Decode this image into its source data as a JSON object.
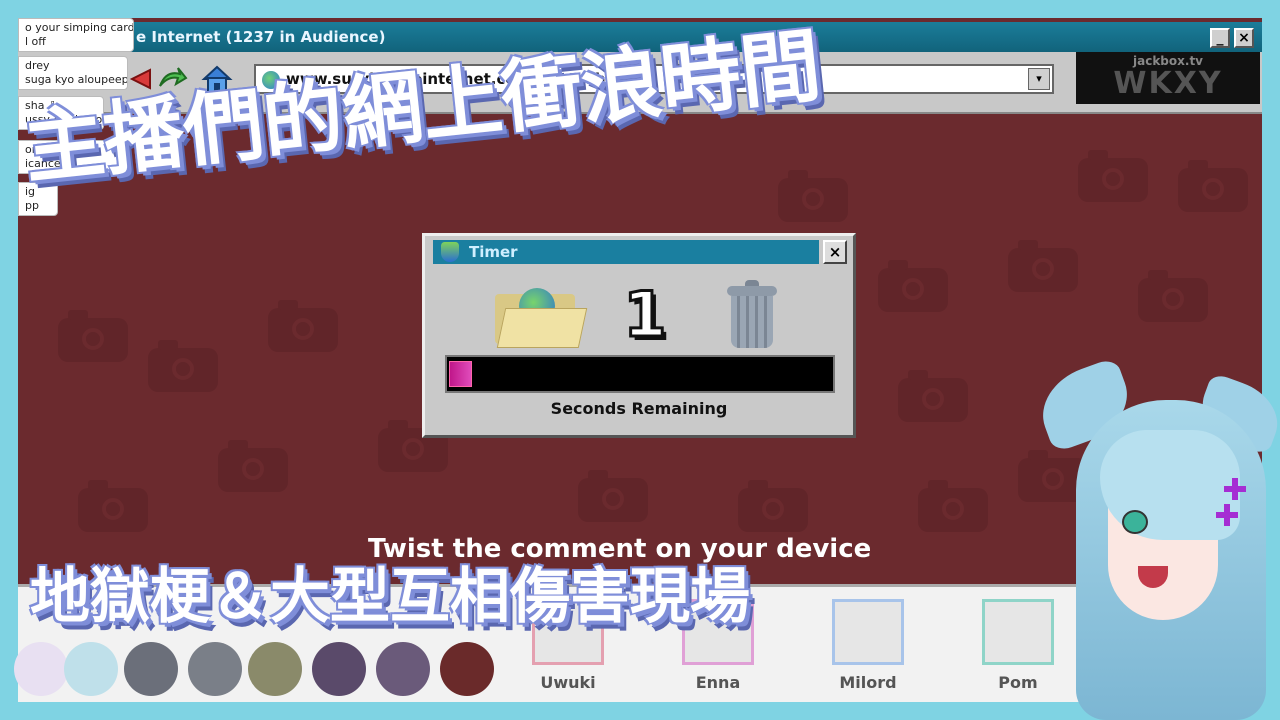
{
  "window": {
    "title": "e Internet  (1237 in Audience)",
    "min_label": "_",
    "close_label": "×"
  },
  "browser": {
    "url": "www.survivetheinternet.com/photosharing",
    "dropdown_label": "▾"
  },
  "logo": {
    "small": "jackbox.tv",
    "big": "WKXY"
  },
  "chat": [
    {
      "line1": "o your simping card",
      "line2": "l off"
    },
    {
      "line1": "drey",
      "line2": "suga kyo aloupeep"
    },
    {
      "line1": "sha ⇩",
      "line2": "ussy era lmao"
    },
    {
      "line1": "ondDeMagen",
      "line2": "icance"
    },
    {
      "line1": "ig",
      "line2": "pp"
    }
  ],
  "timer": {
    "title": "Timer",
    "close_label": "×",
    "count": "1",
    "progress_fraction": 0.06,
    "label": "Seconds Remaining"
  },
  "instruction": "Twist the comment on your device",
  "players": [
    "Uwuki",
    "Enna",
    "Milord",
    "Pom"
  ],
  "captions": {
    "top": "主播們的網上衝浪時間",
    "bottom": "地獄梗＆大型互相傷害現場"
  },
  "colors": {
    "frame": "#6b2a2e",
    "border": "#7fd3e3",
    "titlebar": "#1b7d9a",
    "caption_shadow": "#7f8ed9",
    "progress": "#c0178a"
  }
}
